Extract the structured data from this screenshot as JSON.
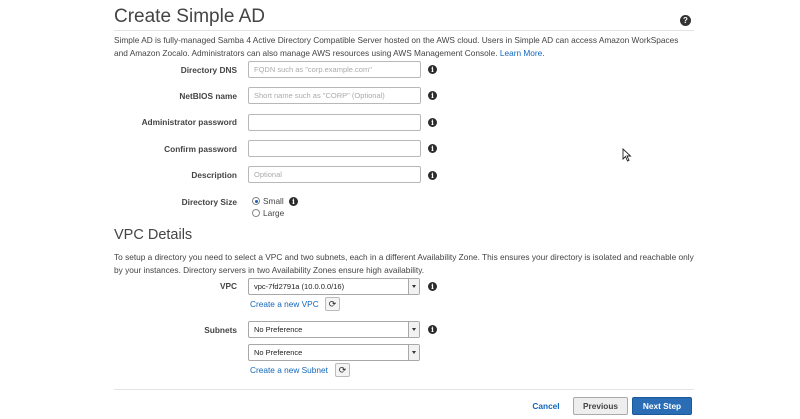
{
  "page": {
    "title": "Create Simple AD",
    "description": "Simple AD is fully-managed Samba 4 Active Directory Compatible Server hosted on the AWS cloud. Users in Simple AD can access Amazon WorkSpaces and Amazon Zocalo. Administrators can also manage AWS resources using AWS Management Console.",
    "learn_more": "Learn More"
  },
  "form": {
    "directory_dns": {
      "label": "Directory DNS",
      "value": "",
      "placeholder": "FQDN such as \"corp.example.com\""
    },
    "netbios": {
      "label": "NetBIOS name",
      "value": "",
      "placeholder": "Short name such as \"CORP\" (Optional)"
    },
    "admin_password": {
      "label": "Administrator password",
      "value": "",
      "placeholder": ""
    },
    "confirm_password": {
      "label": "Confirm password",
      "value": "",
      "placeholder": ""
    },
    "description": {
      "label": "Description",
      "value": "",
      "placeholder": "Optional"
    },
    "directory_size": {
      "label": "Directory Size",
      "options": [
        "Small",
        "Large"
      ],
      "selected": "Small"
    }
  },
  "vpc_section": {
    "title": "VPC Details",
    "description": "To setup a directory you need to select a VPC and two subnets, each in a different Availability Zone. This ensures your directory is isolated and reachable only by your instances. Directory servers in two Availability Zones ensure high availability.",
    "vpc": {
      "label": "VPC",
      "value": "vpc-7fd2791a (10.0.0.0/16)",
      "create_link": "Create a new VPC"
    },
    "subnets": {
      "label": "Subnets",
      "value_1": "No Preference",
      "value_2": "No Preference",
      "create_link": "Create a new Subnet"
    }
  },
  "footer": {
    "cancel": "Cancel",
    "previous": "Previous",
    "next": "Next Step"
  },
  "icons": {
    "help": "help-circle-icon",
    "info": "info-circle-icon",
    "refresh": "refresh-icon",
    "cursor": "mouse-cursor-icon"
  },
  "colors": {
    "link": "#1166bb",
    "primary_button": "#2a6db5"
  }
}
